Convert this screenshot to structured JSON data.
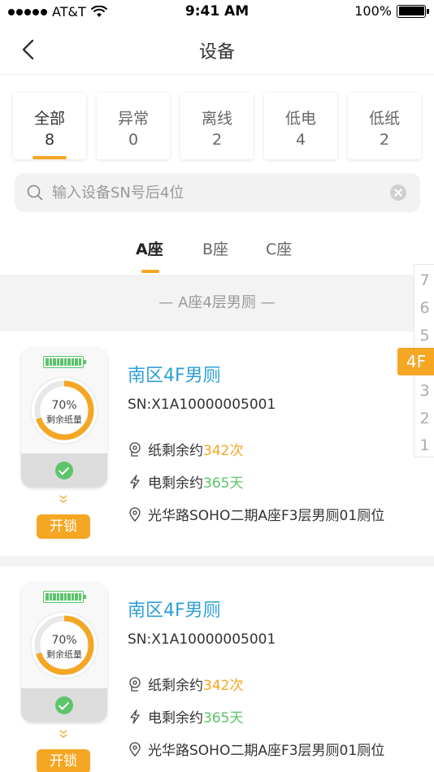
{
  "status_bar": {
    "carrier": "AT&T",
    "time": "9:41 AM",
    "battery": "100%"
  },
  "nav": {
    "title": "设备"
  },
  "categories": [
    {
      "label": "全部",
      "count": "8"
    },
    {
      "label": "异常",
      "count": "0"
    },
    {
      "label": "离线",
      "count": "2"
    },
    {
      "label": "低电",
      "count": "4"
    },
    {
      "label": "低纸",
      "count": "2"
    }
  ],
  "search": {
    "placeholder": "输入设备SN号后4位"
  },
  "building_tabs": [
    "A座",
    "B座",
    "C座"
  ],
  "section_title": "— A座4层男厕 —",
  "floors": [
    "7",
    "6",
    "5",
    "4F",
    "3",
    "2",
    "1"
  ],
  "colors": {
    "accent": "#f5a623",
    "link": "#2e9fd8",
    "ok": "#5cc46a"
  },
  "devices": [
    {
      "name": "南区4F男厕",
      "sn": "SN:X1A10000005001",
      "paper_prefix": "纸剩余约",
      "paper_value": "342次",
      "power_prefix": "电剩余约",
      "power_value": "365天",
      "location": "光华路SOHO二期A座F3层男厕01厕位",
      "gauge_percent": "70%",
      "gauge_fraction": 0.7,
      "gauge_label": "剩余纸量",
      "unlock_label": "开锁"
    },
    {
      "name": "南区4F男厕",
      "sn": "SN:X1A10000005001",
      "paper_prefix": "纸剩余约",
      "paper_value": "342次",
      "power_prefix": "电剩余约",
      "power_value": "365天",
      "location": "光华路SOHO二期A座F3层男厕01厕位",
      "gauge_percent": "70%",
      "gauge_fraction": 0.7,
      "gauge_label": "剩余纸量",
      "unlock_label": "开锁"
    }
  ]
}
